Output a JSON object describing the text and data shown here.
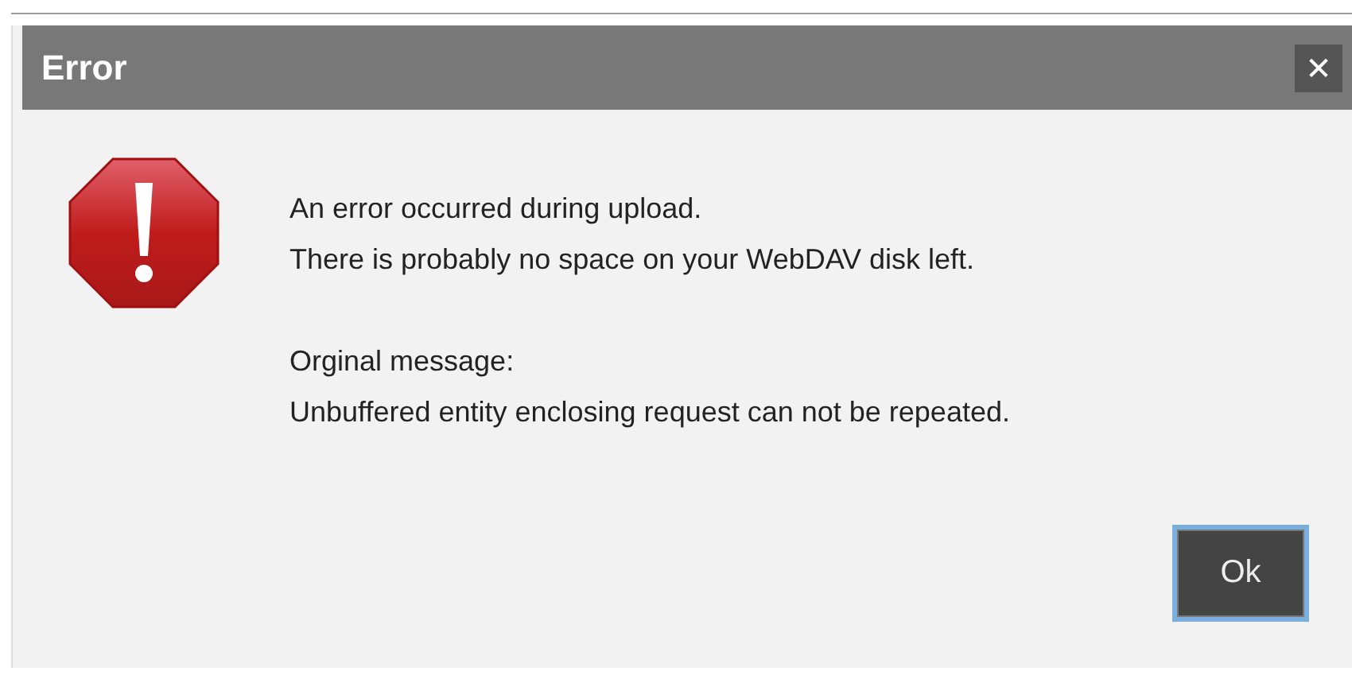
{
  "window": {
    "title": "Error",
    "close": "✕"
  },
  "message": {
    "lines": [
      "An error occurred during upload.",
      "There is probably no space on your WebDAV disk left."
    ],
    "detail_lines": [
      "Orginal message:",
      "Unbuffered entity enclosing request can not be repeated."
    ]
  },
  "buttons": [
    {
      "label": "Ok",
      "focused": true
    }
  ]
}
